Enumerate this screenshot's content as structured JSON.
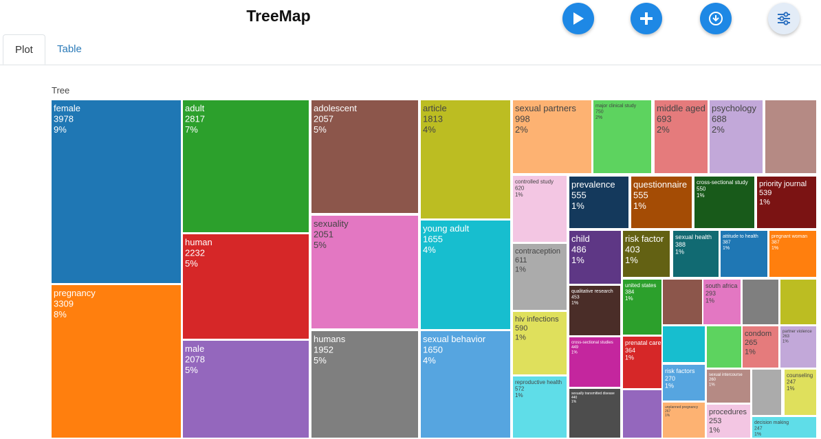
{
  "header": {
    "title": "TreeMap"
  },
  "toolbar": {
    "play_icon": "play-icon",
    "add_icon": "plus-icon",
    "download_icon": "download-icon",
    "settings_icon": "sliders-icon",
    "play_color": "#1e88e5",
    "add_color": "#1e88e5",
    "download_color": "#1e88e5",
    "settings_color": "#e3ecf7"
  },
  "tabs": [
    {
      "label": "Plot",
      "active": true
    },
    {
      "label": "Table",
      "active": false
    }
  ],
  "chart_data": {
    "type": "treemap",
    "root_label": "Tree",
    "items": [
      {
        "label": "female",
        "value": 3978,
        "pct": "9%",
        "color": "#1f77b4"
      },
      {
        "label": "pregnancy",
        "value": 3309,
        "pct": "8%",
        "color": "#ff7f0e"
      },
      {
        "label": "adult",
        "value": 2817,
        "pct": "7%",
        "color": "#2ca02c"
      },
      {
        "label": "human",
        "value": 2232,
        "pct": "5%",
        "color": "#d62728"
      },
      {
        "label": "male",
        "value": 2078,
        "pct": "5%",
        "color": "#9467bd"
      },
      {
        "label": "adolescent",
        "value": 2057,
        "pct": "5%",
        "color": "#8c564b"
      },
      {
        "label": "sexuality",
        "value": 2051,
        "pct": "5%",
        "color": "#e377c2"
      },
      {
        "label": "humans",
        "value": 1952,
        "pct": "5%",
        "color": "#7f7f7f"
      },
      {
        "label": "article",
        "value": 1813,
        "pct": "4%",
        "color": "#bcbd22"
      },
      {
        "label": "young adult",
        "value": 1655,
        "pct": "4%",
        "color": "#17becf"
      },
      {
        "label": "sexual behavior",
        "value": 1650,
        "pct": "4%",
        "color": "#56a5e0"
      },
      {
        "label": "sexual partners",
        "value": 998,
        "pct": "2%",
        "color": "#fdb272"
      },
      {
        "label": "major clinical study",
        "value": 750,
        "pct": "2%",
        "color": "#5dd35f"
      },
      {
        "label": "middle aged",
        "value": 693,
        "pct": "2%",
        "color": "#e57b7c"
      },
      {
        "label": "psychology",
        "value": 688,
        "pct": "2%",
        "color": "#c2a8d9"
      },
      {
        "label": "",
        "value": null,
        "pct": "",
        "color": "#b58a84"
      },
      {
        "label": "controlled study",
        "value": 620,
        "pct": "1%",
        "color": "#f3c6e3"
      },
      {
        "label": "contraception",
        "value": 611,
        "pct": "1%",
        "color": "#ababab"
      },
      {
        "label": "hiv infections",
        "value": 590,
        "pct": "1%",
        "color": "#dfe05c"
      },
      {
        "label": "reproductive health",
        "value": 572,
        "pct": "1%",
        "color": "#5fdde8"
      },
      {
        "label": "prevalence",
        "value": 555,
        "pct": "1%",
        "color": "#14395c"
      },
      {
        "label": "questionnaire",
        "value": 555,
        "pct": "1%",
        "color": "#a44c05"
      },
      {
        "label": "cross-sectional study",
        "value": 550,
        "pct": "1%",
        "color": "#185a1a"
      },
      {
        "label": "priority journal",
        "value": 539,
        "pct": "1%",
        "color": "#7b1313"
      },
      {
        "label": "child",
        "value": 486,
        "pct": "1%",
        "color": "#5e3785"
      },
      {
        "label": "risk factor",
        "value": 403,
        "pct": "1%",
        "color": "#636113"
      },
      {
        "label": "sexual health",
        "value": 388,
        "pct": "1%",
        "color": "#116a72"
      },
      {
        "label": "attitude to health",
        "value": 387,
        "pct": "1%",
        "color": "#1f77b4"
      },
      {
        "label": "pregnant woman",
        "value": 387,
        "pct": "1%",
        "color": "#ff7f0e"
      },
      {
        "label": "qualitative research",
        "value": 453,
        "pct": "1%",
        "color": "#4a2d28"
      },
      {
        "label": "united states",
        "value": 384,
        "pct": "1%",
        "color": "#2ca02c"
      },
      {
        "label": "",
        "value": null,
        "pct": "",
        "color": "#8c564b"
      },
      {
        "label": "south africa",
        "value": 293,
        "pct": "1%",
        "color": "#e377c2"
      },
      {
        "label": "",
        "value": null,
        "pct": "",
        "color": "#7f7f7f"
      },
      {
        "label": "",
        "value": null,
        "pct": "",
        "color": "#bcbd22"
      },
      {
        "label": "cross-sectional studies",
        "value": 449,
        "pct": "1%",
        "color": "#c4269e"
      },
      {
        "label": "prenatal care",
        "value": 364,
        "pct": "1%",
        "color": "#d62728"
      },
      {
        "label": "",
        "value": null,
        "pct": "",
        "color": "#17becf"
      },
      {
        "label": "",
        "value": null,
        "pct": "",
        "color": "#5dd35f"
      },
      {
        "label": "condom",
        "value": 265,
        "pct": "1%",
        "color": "#e57b7c"
      },
      {
        "label": "partner violence",
        "value": 263,
        "pct": "1%",
        "color": "#c2a8d9"
      },
      {
        "label": "sexually transmitted disease",
        "value": 440,
        "pct": "1%",
        "color": "#4d4d4d"
      },
      {
        "label": "",
        "value": null,
        "pct": "",
        "color": "#9467bd"
      },
      {
        "label": "risk factors",
        "value": 270,
        "pct": "1%",
        "color": "#56a5e0"
      },
      {
        "label": "sexual intercourse",
        "value": 260,
        "pct": "1%",
        "color": "#b58a84"
      },
      {
        "label": "",
        "value": null,
        "pct": "",
        "color": "#ababab"
      },
      {
        "label": "counseling",
        "value": 247,
        "pct": "1%",
        "color": "#dfe05c"
      },
      {
        "label": "unplanned pregnancy",
        "value": 267,
        "pct": "1%",
        "color": "#fdb272"
      },
      {
        "label": "procedures",
        "value": 253,
        "pct": "1%",
        "color": "#f3c6e3"
      },
      {
        "label": "decision making",
        "value": 247,
        "pct": "1%",
        "color": "#5fdde8"
      }
    ]
  }
}
